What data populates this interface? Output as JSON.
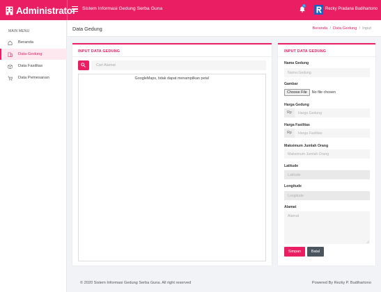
{
  "brand": {
    "name": "Administrator"
  },
  "header": {
    "app_title": "Sistem Informasi Gedung Serba Guna",
    "notification_count": "1",
    "username": "Rezky Pradana Budihartono"
  },
  "sidebar": {
    "header": "MAIN MENU",
    "items": [
      {
        "label": "Beranda",
        "icon": "home-icon",
        "active": false
      },
      {
        "label": "Data Gedung",
        "icon": "building-icon",
        "active": true
      },
      {
        "label": "Data Fasilitas",
        "icon": "box-icon",
        "active": false
      },
      {
        "label": "Data Pemesanan",
        "icon": "cart-icon",
        "active": false
      }
    ]
  },
  "subheader": {
    "page_title": "Data Gedung",
    "breadcrumb": [
      "Beranda",
      "Data Gedung",
      "Input"
    ]
  },
  "map_card": {
    "title": "INPUT DATA GEDUNG",
    "search_placeholder": "Cari Alamat",
    "map_message": "GoogleMaps, tidak dapat menampilkan peta!"
  },
  "form_card": {
    "title": "INPUT DATA GEDUNG",
    "nama": {
      "label": "Nama Gedung",
      "placeholder": "Nama Gedung"
    },
    "gambar": {
      "label": "Gambar",
      "button": "Choose File",
      "status": "No file chosen"
    },
    "harga_gedung": {
      "label": "Harga Gedung",
      "prefix": "Rp",
      "placeholder": "Harga Gedung"
    },
    "harga_fasilitas": {
      "label": "Harga Fasilitas",
      "prefix": "Rp",
      "placeholder": "Harga Fasilitas"
    },
    "maks_orang": {
      "label": "Maksimum Jumlah Orang",
      "placeholder": "Maksimum Jumlah Orang"
    },
    "latitude": {
      "label": "Latitude",
      "placeholder": "Latitude"
    },
    "longitude": {
      "label": "Longitude",
      "placeholder": "Longitude"
    },
    "alamat": {
      "label": "Alamat",
      "placeholder": "Alamat"
    },
    "save_label": "Simpan",
    "cancel_label": "Batal"
  },
  "footer": {
    "copyright": "© 2020 Sistem Informasi Gedung Serba Guna. All right reserved",
    "powered": "Powered By Rezky P. Budihartono"
  },
  "colors": {
    "accent": "#e91e63",
    "badge": "#2196f3",
    "cancel": "#4a5560"
  }
}
